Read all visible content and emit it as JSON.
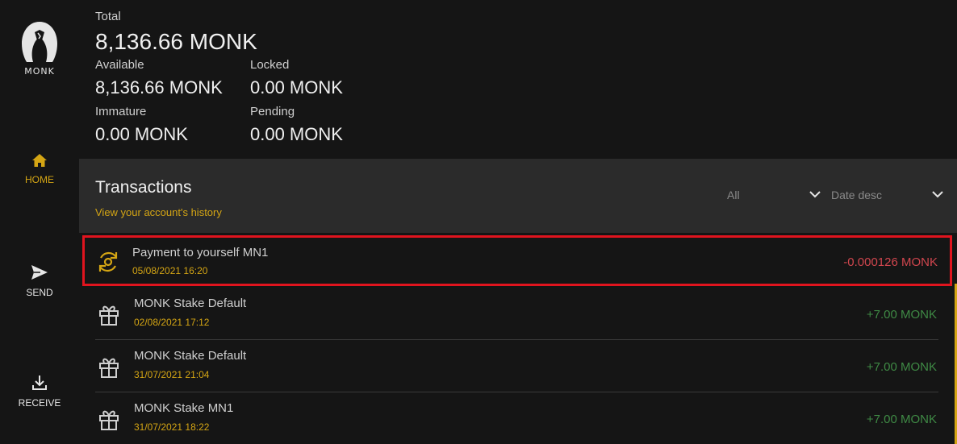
{
  "brand": {
    "name": "MONK"
  },
  "colors": {
    "accent": "#d4a514",
    "negative": "#d0464e",
    "positive": "#3f8a45",
    "highlight": "#e0141e"
  },
  "nav": {
    "home": {
      "label": "HOME",
      "icon": "home-icon"
    },
    "send": {
      "label": "SEND",
      "icon": "send-icon"
    },
    "receive": {
      "label": "RECEIVE",
      "icon": "download-icon"
    }
  },
  "balances": {
    "total_label": "Total",
    "total_value": "8,136.66 MONK",
    "available_label": "Available",
    "available_value": "8,136.66 MONK",
    "locked_label": "Locked",
    "locked_value": "0.00 MONK",
    "immature_label": "Immature",
    "immature_value": "0.00 MONK",
    "pending_label": "Pending",
    "pending_value": "0.00 MONK"
  },
  "transactions": {
    "title": "Transactions",
    "subtitle": "View your account's history",
    "filter_type": "All",
    "sort": "Date desc",
    "items": [
      {
        "name": "Payment to yourself MN1",
        "date": "05/08/2021 16:20",
        "amount": "-0.000126 MONK",
        "icon": "self-payment-icon"
      },
      {
        "name": "MONK Stake Default",
        "date": "02/08/2021 17:12",
        "amount": "+7.00 MONK",
        "icon": "gift-icon"
      },
      {
        "name": "MONK Stake Default",
        "date": "31/07/2021 21:04",
        "amount": "+7.00 MONK",
        "icon": "gift-icon"
      },
      {
        "name": "MONK Stake MN1",
        "date": "31/07/2021 18:22",
        "amount": "+7.00 MONK",
        "icon": "gift-icon"
      }
    ]
  }
}
